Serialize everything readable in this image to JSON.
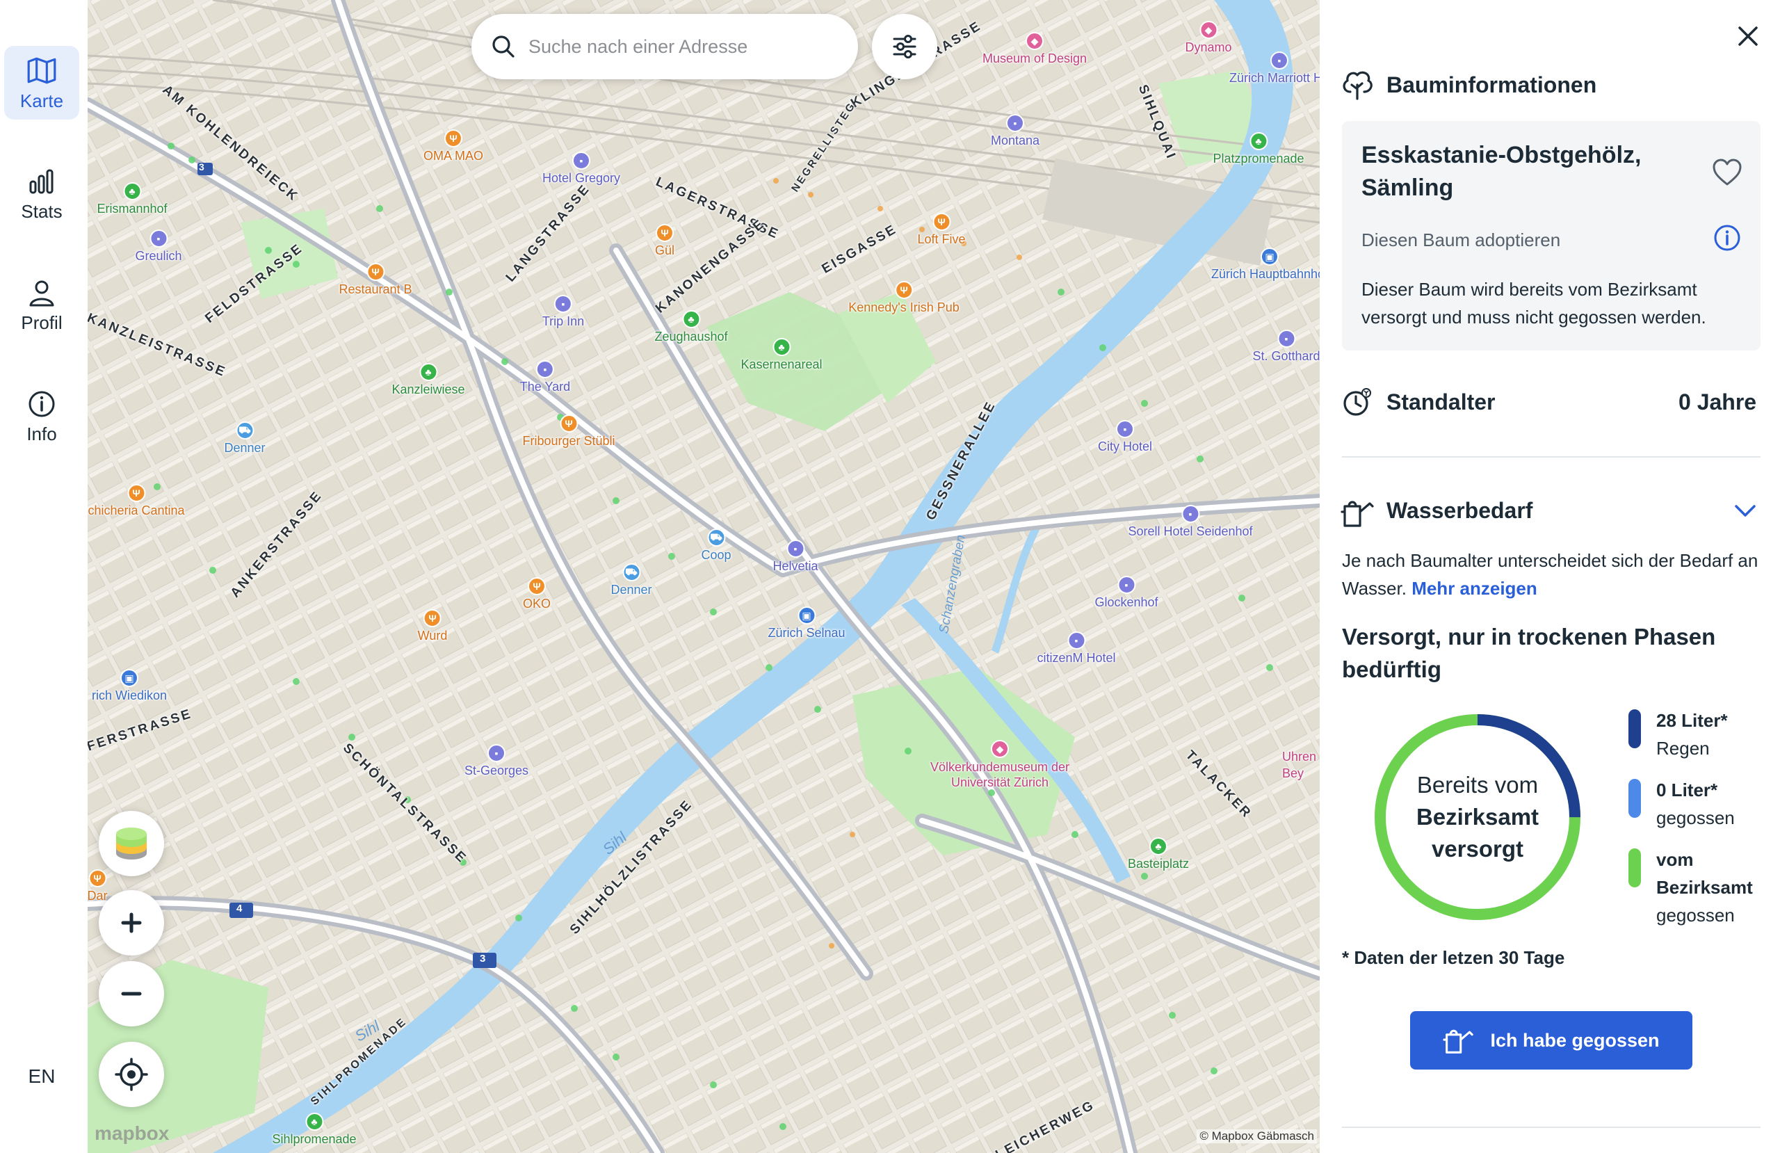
{
  "nav": {
    "items": [
      {
        "label": "Karte",
        "icon": "map-icon",
        "active": true
      },
      {
        "label": "Stats",
        "icon": "bar-chart-icon",
        "active": false
      },
      {
        "label": "Profil",
        "icon": "user-icon",
        "active": false
      },
      {
        "label": "Info",
        "icon": "info-icon",
        "active": false
      }
    ],
    "language": "EN"
  },
  "search": {
    "placeholder": "Suche nach einer Adresse"
  },
  "map": {
    "attribution": "© Mapbox",
    "attribution_overlap": "Gäbmasch",
    "logo": "mapbox",
    "street_labels": [
      "AM KOHLENDREIECK",
      "KLINGENSTRASSE",
      "NEGRELLISTEG",
      "SIHLQUAI",
      "LAGERSTRASSE",
      "LANGSTRASSE",
      "KANONENGASSE",
      "EISGASSE",
      "FELDSTRASSE",
      "KANZLEISTRASSE",
      "ANKERSTRASSE",
      "GESSNERALLEE",
      "SCHÖNTALSTRASSE",
      "SIHLHÖLZLISTRASSE",
      "TALACKER",
      "SIHLPROMENADE",
      "GLEICHERWEG",
      "FERSTRASSE"
    ],
    "pois": [
      "Museum of Design",
      "Dynamo",
      "Zürich Marriott Ho",
      "OMA MAO",
      "Hotel Gregory",
      "Montana",
      "Platzpromenade",
      "Erismannhof",
      "Greulich",
      "Gül",
      "Loft Five",
      "Restaurant B",
      "Zürich Hauptbahnhof",
      "Trip Inn",
      "Zeughaushof",
      "Kennedy's Irish Pub",
      "Kasernenareal",
      "St. Gotthard",
      "Kanzleiwiese",
      "The Yard",
      "Denner",
      "Fribourger Stübli",
      "City Hotel",
      "chicheria Cantina",
      "Sorell Hotel Seidenhof",
      "Coop",
      "Helvetia",
      "Denner",
      "OKO",
      "Glockenhof",
      "Zürich Selnau",
      "Wurd",
      "citizenM Hotel",
      "rich Wiedikon",
      "St-Georges",
      "Völkerkundemuseum der Universität Zürich",
      "Uhren Bey",
      "Basteiplatz",
      "Dar",
      "Sihlpromenade"
    ],
    "rivers": [
      "Sihl",
      "Sihl",
      "Schanzengraben"
    ],
    "route_numbers": [
      "3",
      "4",
      "3"
    ]
  },
  "panel": {
    "title": "Bauminformationen",
    "tree_name": "Esskastanie-Obstgehölz, Sämling",
    "adopt_label": "Diesen Baum adoptieren",
    "status_text": "Dieser Baum wird bereits vom Bezirksamt versorgt und muss nicht gegossen werden.",
    "age_label": "Standalter",
    "age_value": "0 Jahre",
    "water_label": "Wasserbedarf",
    "water_intro": "Je nach Baumalter unterscheidet sich der Bedarf an Wasser.",
    "more_link": "Mehr anzeigen",
    "supply_title": "Versorgt, nur in trockenen Phasen bedürftig",
    "donut_line1": "Bereits vom",
    "donut_line2": "Bezirksamt",
    "donut_line3": "versorgt",
    "legend": [
      {
        "value": "28 Liter*",
        "label": "Regen",
        "color": "#1f3f8f"
      },
      {
        "value": "0 Liter*",
        "label": "gegossen",
        "color": "#4d8ae8"
      },
      {
        "value": "vom Bezirksamt",
        "label": "gegossen",
        "color": "#6cd14f"
      }
    ],
    "donut_fractions": {
      "rain": 0.25,
      "watered": 0.0,
      "district": 0.75
    },
    "footnote": "* Daten der letzen 30 Tage",
    "cta": "Ich habe gegossen"
  },
  "colors": {
    "accent": "#2a5fd8",
    "rain": "#1f3f8f",
    "watered": "#4d8ae8",
    "district": "#6cd14f",
    "park": "#bfe8b4",
    "water": "#a8d4f4"
  }
}
